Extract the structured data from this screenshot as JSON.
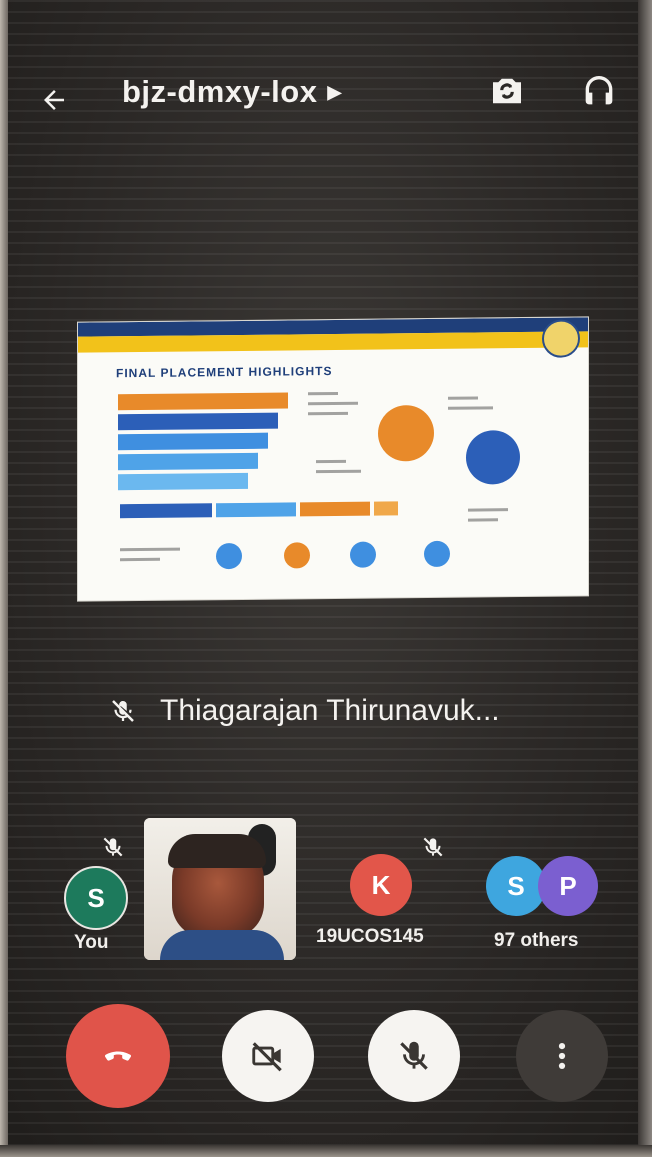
{
  "header": {
    "meeting_code": "bjz-dmxy-lox",
    "back_icon": "arrow-back-icon",
    "switch_camera_icon": "switch-camera-icon",
    "audio_output_icon": "headphones-icon"
  },
  "presentation": {
    "heading": "FINAL PLACEMENT HIGHLIGHTS",
    "accent_colors": {
      "blue": "#1f3f7a",
      "yellow": "#f2c21a",
      "orange": "#e88a2a",
      "light_blue": "#3f8fe0"
    }
  },
  "speaker": {
    "name": "Thiagarajan Thirunavuk...",
    "muted_icon": "mic-off-icon"
  },
  "participants": [
    {
      "label": "You",
      "initial": "S",
      "color": "#1d7a5c",
      "muted": true
    },
    {
      "label": "",
      "video": true
    },
    {
      "label": "19UCOS145",
      "initial": "K",
      "color": "#e2564a",
      "muted": true
    },
    {
      "label": "97 others",
      "initials": [
        "S",
        "P"
      ],
      "colors": [
        "#3ea6df",
        "#7b5fd0"
      ]
    }
  ],
  "controls": {
    "end_call_icon": "end-call-icon",
    "camera_icon": "camera-off-icon",
    "mic_icon": "mic-off-icon",
    "more_icon": "more-vert-icon",
    "end_call_color": "#e0544a"
  }
}
